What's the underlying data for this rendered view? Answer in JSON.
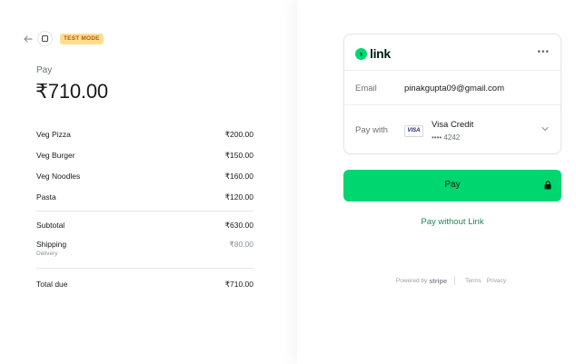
{
  "header": {
    "back_icon": "arrow-left-icon",
    "merchant_icon": "store-icon",
    "test_badge": "TEST MODE"
  },
  "summary": {
    "pay_label": "Pay",
    "amount": "₹710.00",
    "items": [
      {
        "name": "Veg Pizza",
        "price": "₹200.00"
      },
      {
        "name": "Veg Burger",
        "price": "₹150.00"
      },
      {
        "name": "Veg Noodles",
        "price": "₹160.00"
      },
      {
        "name": "Pasta",
        "price": "₹120.00"
      }
    ],
    "subtotal_label": "Subtotal",
    "subtotal_value": "₹630.00",
    "shipping_label": "Shipping",
    "shipping_sub": "Delivery",
    "shipping_value": "₹80.00",
    "total_label": "Total due",
    "total_value": "₹710.00"
  },
  "link": {
    "brand": "link",
    "email_label": "Email",
    "email_value": "pinakgupta09@gmail.com",
    "paywith_label": "Pay with",
    "card_brand": "VISA",
    "card_name": "Visa Credit",
    "card_last4": "•••• 4242"
  },
  "actions": {
    "pay_label": "Pay",
    "pay_without_link": "Pay without Link"
  },
  "footer": {
    "powered_by": "Powered by",
    "stripe": "stripe",
    "terms": "Terms",
    "privacy": "Privacy"
  },
  "colors": {
    "link_green": "#00d66f",
    "link_text_green": "#1a8a54",
    "test_badge_bg": "#ffde92",
    "test_badge_text": "#bb5504"
  }
}
